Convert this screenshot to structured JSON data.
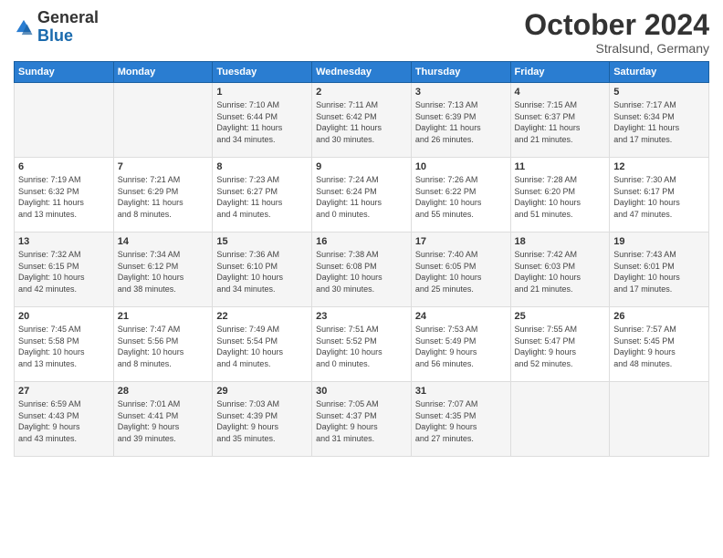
{
  "logo": {
    "general": "General",
    "blue": "Blue"
  },
  "header": {
    "month": "October 2024",
    "location": "Stralsund, Germany"
  },
  "weekdays": [
    "Sunday",
    "Monday",
    "Tuesday",
    "Wednesday",
    "Thursday",
    "Friday",
    "Saturday"
  ],
  "weeks": [
    [
      {
        "day": "",
        "info": ""
      },
      {
        "day": "",
        "info": ""
      },
      {
        "day": "1",
        "info": "Sunrise: 7:10 AM\nSunset: 6:44 PM\nDaylight: 11 hours\nand 34 minutes."
      },
      {
        "day": "2",
        "info": "Sunrise: 7:11 AM\nSunset: 6:42 PM\nDaylight: 11 hours\nand 30 minutes."
      },
      {
        "day": "3",
        "info": "Sunrise: 7:13 AM\nSunset: 6:39 PM\nDaylight: 11 hours\nand 26 minutes."
      },
      {
        "day": "4",
        "info": "Sunrise: 7:15 AM\nSunset: 6:37 PM\nDaylight: 11 hours\nand 21 minutes."
      },
      {
        "day": "5",
        "info": "Sunrise: 7:17 AM\nSunset: 6:34 PM\nDaylight: 11 hours\nand 17 minutes."
      }
    ],
    [
      {
        "day": "6",
        "info": "Sunrise: 7:19 AM\nSunset: 6:32 PM\nDaylight: 11 hours\nand 13 minutes."
      },
      {
        "day": "7",
        "info": "Sunrise: 7:21 AM\nSunset: 6:29 PM\nDaylight: 11 hours\nand 8 minutes."
      },
      {
        "day": "8",
        "info": "Sunrise: 7:23 AM\nSunset: 6:27 PM\nDaylight: 11 hours\nand 4 minutes."
      },
      {
        "day": "9",
        "info": "Sunrise: 7:24 AM\nSunset: 6:24 PM\nDaylight: 11 hours\nand 0 minutes."
      },
      {
        "day": "10",
        "info": "Sunrise: 7:26 AM\nSunset: 6:22 PM\nDaylight: 10 hours\nand 55 minutes."
      },
      {
        "day": "11",
        "info": "Sunrise: 7:28 AM\nSunset: 6:20 PM\nDaylight: 10 hours\nand 51 minutes."
      },
      {
        "day": "12",
        "info": "Sunrise: 7:30 AM\nSunset: 6:17 PM\nDaylight: 10 hours\nand 47 minutes."
      }
    ],
    [
      {
        "day": "13",
        "info": "Sunrise: 7:32 AM\nSunset: 6:15 PM\nDaylight: 10 hours\nand 42 minutes."
      },
      {
        "day": "14",
        "info": "Sunrise: 7:34 AM\nSunset: 6:12 PM\nDaylight: 10 hours\nand 38 minutes."
      },
      {
        "day": "15",
        "info": "Sunrise: 7:36 AM\nSunset: 6:10 PM\nDaylight: 10 hours\nand 34 minutes."
      },
      {
        "day": "16",
        "info": "Sunrise: 7:38 AM\nSunset: 6:08 PM\nDaylight: 10 hours\nand 30 minutes."
      },
      {
        "day": "17",
        "info": "Sunrise: 7:40 AM\nSunset: 6:05 PM\nDaylight: 10 hours\nand 25 minutes."
      },
      {
        "day": "18",
        "info": "Sunrise: 7:42 AM\nSunset: 6:03 PM\nDaylight: 10 hours\nand 21 minutes."
      },
      {
        "day": "19",
        "info": "Sunrise: 7:43 AM\nSunset: 6:01 PM\nDaylight: 10 hours\nand 17 minutes."
      }
    ],
    [
      {
        "day": "20",
        "info": "Sunrise: 7:45 AM\nSunset: 5:58 PM\nDaylight: 10 hours\nand 13 minutes."
      },
      {
        "day": "21",
        "info": "Sunrise: 7:47 AM\nSunset: 5:56 PM\nDaylight: 10 hours\nand 8 minutes."
      },
      {
        "day": "22",
        "info": "Sunrise: 7:49 AM\nSunset: 5:54 PM\nDaylight: 10 hours\nand 4 minutes."
      },
      {
        "day": "23",
        "info": "Sunrise: 7:51 AM\nSunset: 5:52 PM\nDaylight: 10 hours\nand 0 minutes."
      },
      {
        "day": "24",
        "info": "Sunrise: 7:53 AM\nSunset: 5:49 PM\nDaylight: 9 hours\nand 56 minutes."
      },
      {
        "day": "25",
        "info": "Sunrise: 7:55 AM\nSunset: 5:47 PM\nDaylight: 9 hours\nand 52 minutes."
      },
      {
        "day": "26",
        "info": "Sunrise: 7:57 AM\nSunset: 5:45 PM\nDaylight: 9 hours\nand 48 minutes."
      }
    ],
    [
      {
        "day": "27",
        "info": "Sunrise: 6:59 AM\nSunset: 4:43 PM\nDaylight: 9 hours\nand 43 minutes."
      },
      {
        "day": "28",
        "info": "Sunrise: 7:01 AM\nSunset: 4:41 PM\nDaylight: 9 hours\nand 39 minutes."
      },
      {
        "day": "29",
        "info": "Sunrise: 7:03 AM\nSunset: 4:39 PM\nDaylight: 9 hours\nand 35 minutes."
      },
      {
        "day": "30",
        "info": "Sunrise: 7:05 AM\nSunset: 4:37 PM\nDaylight: 9 hours\nand 31 minutes."
      },
      {
        "day": "31",
        "info": "Sunrise: 7:07 AM\nSunset: 4:35 PM\nDaylight: 9 hours\nand 27 minutes."
      },
      {
        "day": "",
        "info": ""
      },
      {
        "day": "",
        "info": ""
      }
    ]
  ]
}
